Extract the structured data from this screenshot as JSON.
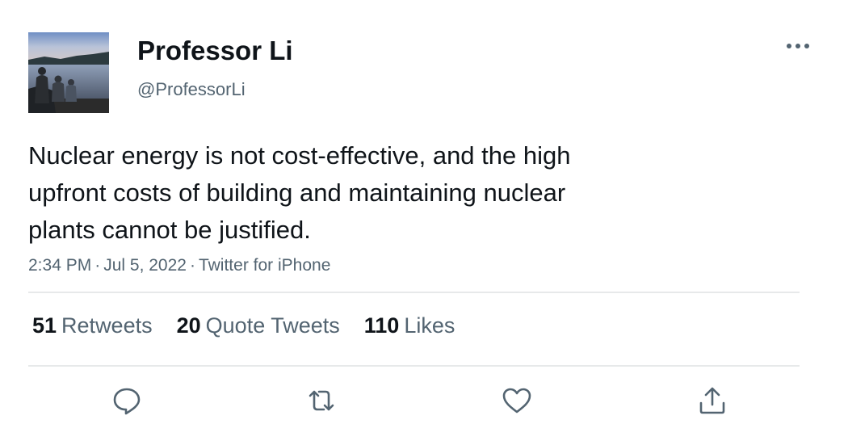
{
  "user": {
    "name": "Professor Li",
    "handle": "@ProfessorLi",
    "avatar_icon": "profile-photo-lakeside"
  },
  "tweet": {
    "text": "Nuclear energy is not cost-effective, and the high\nupfront costs of building and maintaining nuclear\nplants cannot be justified.",
    "time": "2:34 PM",
    "date": "Jul 5, 2022",
    "source": "Twitter for iPhone",
    "separator": "·"
  },
  "stats": {
    "retweets": {
      "count": "51",
      "label": "Retweets"
    },
    "quotes": {
      "count": "20",
      "label": "Quote Tweets"
    },
    "likes": {
      "count": "110",
      "label": "Likes"
    }
  },
  "actions": [
    "reply-icon",
    "retweet-icon",
    "like-icon",
    "share-icon"
  ],
  "colors": {
    "text": "#0f1419",
    "secondary": "#536471",
    "divider": "#e7e9ea"
  }
}
